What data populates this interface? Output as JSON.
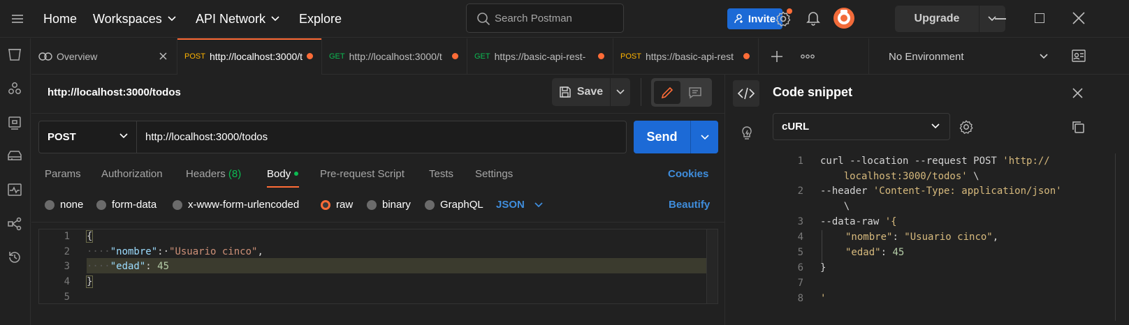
{
  "topbar": {
    "nav": [
      "Home",
      "Workspaces",
      "API Network",
      "Explore"
    ],
    "search_placeholder": "Search Postman",
    "invite_label": "Invite",
    "upgrade_label": "Upgrade"
  },
  "tabs": [
    {
      "method": "",
      "label": "Overview"
    },
    {
      "method": "POST",
      "label": "http://localhost:3000/t"
    },
    {
      "method": "GET",
      "label": "http://localhost:3000/t"
    },
    {
      "method": "GET",
      "label": "https://basic-api-rest-"
    },
    {
      "method": "POST",
      "label": "https://basic-api-rest"
    }
  ],
  "environment": "No Environment",
  "request": {
    "title": "http://localhost:3000/todos",
    "save_label": "Save",
    "method": "POST",
    "url": "http://localhost:3000/todos",
    "send_label": "Send",
    "tabs": [
      "Params",
      "Authorization",
      "Headers",
      "Body",
      "Pre-request Script",
      "Tests",
      "Settings"
    ],
    "headers_count": "(8)",
    "cookies_label": "Cookies",
    "body_types": [
      "none",
      "form-data",
      "x-www-form-urlencoded",
      "raw",
      "binary",
      "GraphQL"
    ],
    "body_format": "JSON",
    "beautify_label": "Beautify"
  },
  "editor": {
    "line_numbers": [
      "1",
      "2",
      "3",
      "4",
      "5"
    ],
    "line1": "{",
    "line2_key": "\"nombre\"",
    "line2_val": "\"Usuario cinco\"",
    "line3_key": "\"edad\"",
    "line3_val": "45",
    "line4": "}"
  },
  "snippet": {
    "title": "Code snippet",
    "language": "cURL",
    "line_numbers": [
      "1",
      "2",
      "3",
      "4",
      "5",
      "6",
      "7",
      "8"
    ],
    "l1a": "curl --location --request POST ",
    "l1b": "'http://",
    "l1c": "    localhost:3000/todos'",
    "l1d": " \\",
    "l2a": "--header ",
    "l2b": "'Content-Type: application/json'",
    "l2c": "    \\",
    "l3a": "--data-raw ",
    "l3b": "'{",
    "l4k": "\"nombre\"",
    "l4v": "\"Usuario cinco\"",
    "l5k": "\"edad\"",
    "l5v": "45",
    "l6": "}",
    "l8": "'"
  },
  "colors": {
    "accent": "#ff6c37",
    "primary": "#1c6ad6",
    "link": "#3f8ddc",
    "background": "#212121"
  }
}
